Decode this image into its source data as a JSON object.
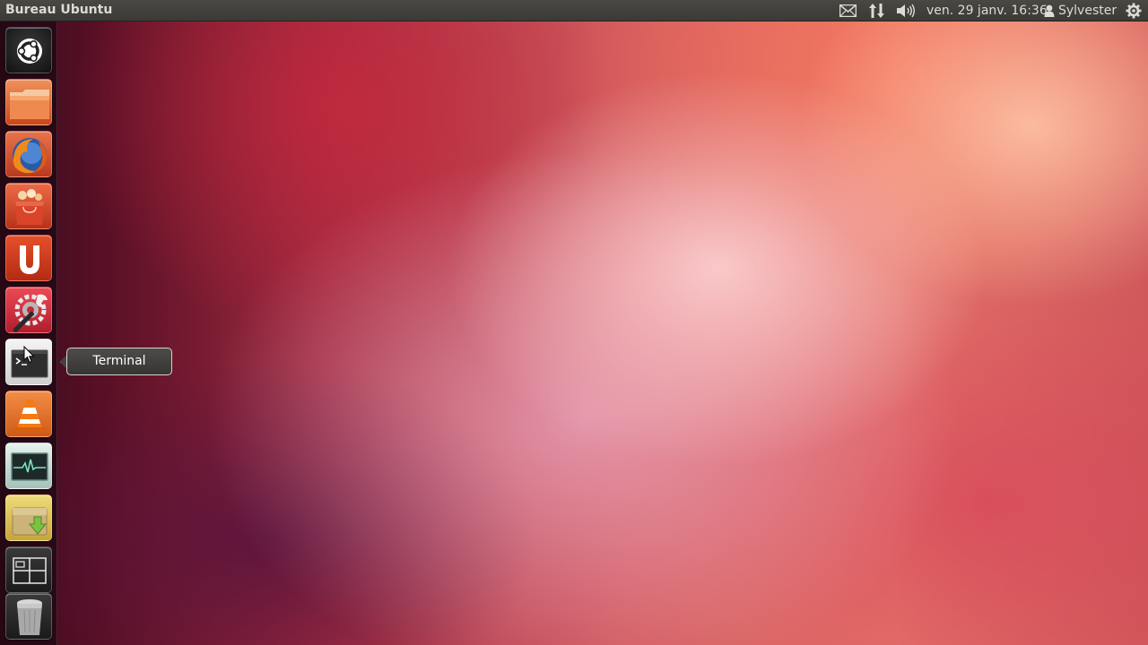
{
  "topbar": {
    "title": "Bureau Ubuntu",
    "indicators": {
      "mail_icon": "envelope-icon",
      "network_icon": "network-arrows-icon",
      "sound_icon": "speaker-icon",
      "clock": "ven. 29 janv. 16:36",
      "user_icon": "person-icon",
      "user": "Sylvester",
      "session_icon": "gear-icon"
    }
  },
  "launcher": {
    "items": [
      {
        "name": "dash-home",
        "icon": "ubuntu-logo-icon"
      },
      {
        "name": "files",
        "icon": "folder-icon"
      },
      {
        "name": "firefox",
        "icon": "firefox-icon"
      },
      {
        "name": "software-center",
        "icon": "shopping-bag-icon"
      },
      {
        "name": "ubuntu-one",
        "icon": "ubuntu-one-icon"
      },
      {
        "name": "system-settings",
        "icon": "wrench-gear-icon"
      },
      {
        "name": "terminal",
        "icon": "terminal-icon"
      },
      {
        "name": "vlc",
        "icon": "traffic-cone-icon"
      },
      {
        "name": "system-monitor",
        "icon": "pulse-graph-icon"
      },
      {
        "name": "archive-manager",
        "icon": "package-download-icon"
      },
      {
        "name": "workspace-switcher",
        "icon": "workspaces-icon"
      },
      {
        "name": "trash",
        "icon": "trash-icon"
      }
    ]
  },
  "tooltip": {
    "label": "Terminal"
  },
  "colors": {
    "panel": "#3c3b37",
    "panel_text": "#dfdbd2",
    "tooltip_bg": "#413f3d"
  }
}
